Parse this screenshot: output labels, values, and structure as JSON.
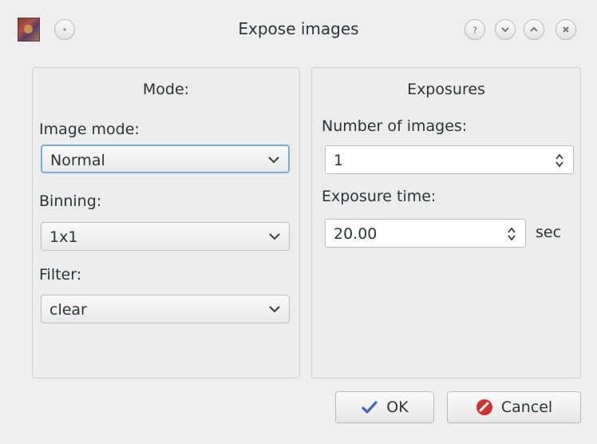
{
  "window": {
    "title": "Expose images"
  },
  "mode_panel": {
    "title": "Mode:",
    "image_mode": {
      "label": "Image mode:",
      "value": "Normal"
    },
    "binning": {
      "label": "Binning:",
      "value": "1x1"
    },
    "filter": {
      "label": "Filter:",
      "value": "clear"
    }
  },
  "exposures_panel": {
    "title": "Exposures",
    "number_of_images": {
      "label": "Number of images:",
      "value": "1"
    },
    "exposure_time": {
      "label": "Exposure time:",
      "value": "20.00",
      "unit": "sec"
    }
  },
  "buttons": {
    "ok": "OK",
    "cancel": "Cancel"
  },
  "colors": {
    "focus_border": "#77aee2",
    "ok_check": "#3e63c7",
    "cancel_red": "#d0312d"
  },
  "icons": [
    "app-icon",
    "menu-circle-icon",
    "help-icon",
    "minimize-icon",
    "maximize-icon",
    "close-icon",
    "chevron-down-icon",
    "spin-updown-icon",
    "check-icon",
    "cancel-icon"
  ]
}
